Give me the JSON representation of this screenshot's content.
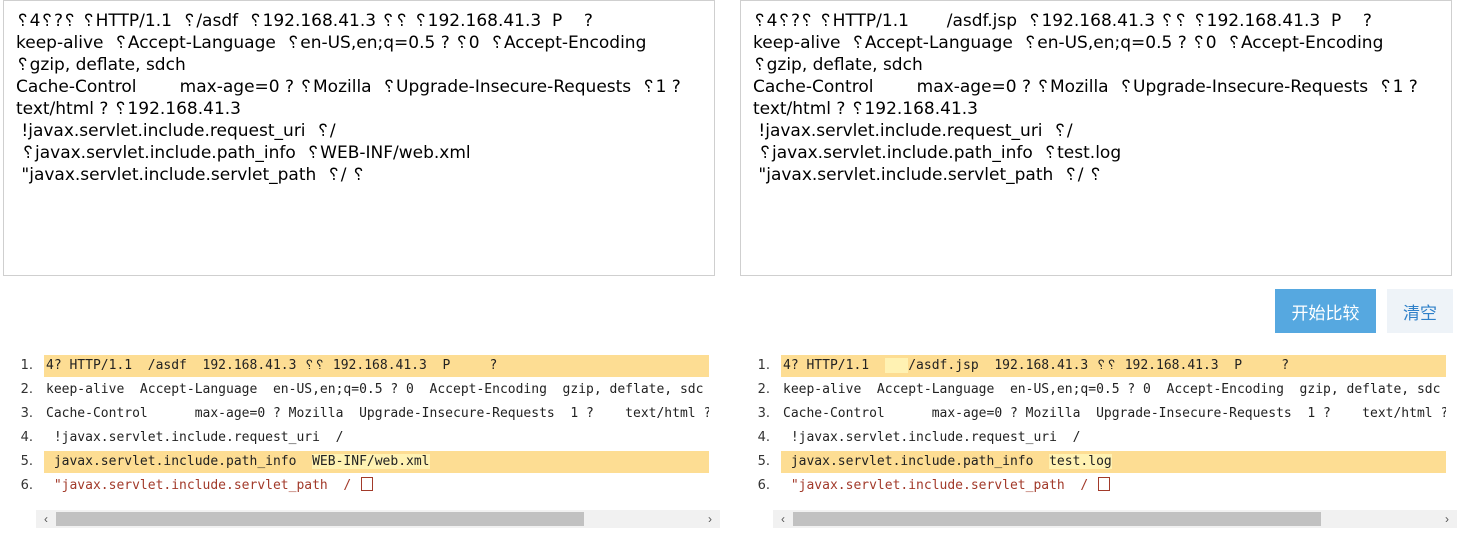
{
  "inputs": {
    "left": "␦4␦?␦ ␦HTTP/1.1  ␦/asdf  ␦192.168.41.3 ␦␦ ␦192.168.41.3  P    ?\nkeep-alive  ␦Accept-Language  ␦en-US,en;q=0.5 ? ␦0  ␦Accept-Encoding  ␦gzip, deflate, sdch\nCache-Control        max-age=0 ? ␦Mozilla  ␦Upgrade-Insecure-Requests  ␦1 ?\ntext/html ? ␦192.168.41.3\n !javax.servlet.include.request_uri  ␦/\n ␦javax.servlet.include.path_info  ␦WEB-INF/web.xml\n \"javax.servlet.include.servlet_path  ␦/ ␦",
    "right": "␦4␦?␦ ␦HTTP/1.1       /asdf.jsp  ␦192.168.41.3 ␦␦ ␦192.168.41.3  P    ?\nkeep-alive  ␦Accept-Language  ␦en-US,en;q=0.5 ? ␦0  ␦Accept-Encoding  ␦gzip, deflate, sdch\nCache-Control        max-age=0 ? ␦Mozilla  ␦Upgrade-Insecure-Requests  ␦1 ?\ntext/html ? ␦192.168.41.3\n !javax.servlet.include.request_uri  ␦/\n ␦javax.servlet.include.path_info  ␦test.log\n \"javax.servlet.include.servlet_path  ␦/ ␦"
  },
  "buttons": {
    "compare": "开始比较",
    "clear": "清空"
  },
  "diff": {
    "left": [
      {
        "num": "1.",
        "pre": "4? HTTP/1.1  /asdf  192.168.41.3 ␦␦ 192.168.41.3  P     ?",
        "hl": "",
        "post": ""
      },
      {
        "num": "2.",
        "pre": "keep-alive  Accept-Language  en-US,en;q=0.5 ? 0  Accept-Encoding  gzip, deflate, sdc",
        "hl": "",
        "post": ""
      },
      {
        "num": "3.",
        "pre": "Cache-Control      max-age=0 ? Mozilla  Upgrade-Insecure-Requests  1 ?    text/html ?",
        "hl": "",
        "post": ""
      },
      {
        "num": "4.",
        "pre": " !javax.servlet.include.request_uri  /",
        "hl": "",
        "post": ""
      },
      {
        "num": "5.",
        "pre": " javax.servlet.include.path_info  ",
        "hl": "WEB-INF/web.xml",
        "post": ""
      },
      {
        "num": "6.",
        "pre": " \"javax.servlet.include.servlet_path  / ",
        "hl": "",
        "post": ""
      }
    ],
    "right": [
      {
        "num": "1.",
        "pre": "4? HTTP/1.1  ",
        "hl": "   ",
        "post": "/asdf.jsp  192.168.41.3 ␦␦ 192.168.41.3  P     ?"
      },
      {
        "num": "2.",
        "pre": "keep-alive  Accept-Language  en-US,en;q=0.5 ? 0  Accept-Encoding  gzip, deflate, sdc",
        "hl": "",
        "post": ""
      },
      {
        "num": "3.",
        "pre": "Cache-Control      max-age=0 ? Mozilla  Upgrade-Insecure-Requests  1 ?    text/html ?",
        "hl": "",
        "post": ""
      },
      {
        "num": "4.",
        "pre": " !javax.servlet.include.request_uri  /",
        "hl": "",
        "post": ""
      },
      {
        "num": "5.",
        "pre": " javax.servlet.include.path_info  ",
        "hl": "test.log",
        "post": ""
      },
      {
        "num": "6.",
        "pre": " \"javax.servlet.include.servlet_path  / ",
        "hl": "",
        "post": ""
      }
    ]
  },
  "scrollbars": {
    "left_arrow": "‹",
    "right_arrow": "›"
  },
  "colors": {
    "changed_line": "#fddd93",
    "changed_text": "#fff2b3",
    "compare_button": "#56a8e0",
    "removed_text": "#a23a2a"
  }
}
